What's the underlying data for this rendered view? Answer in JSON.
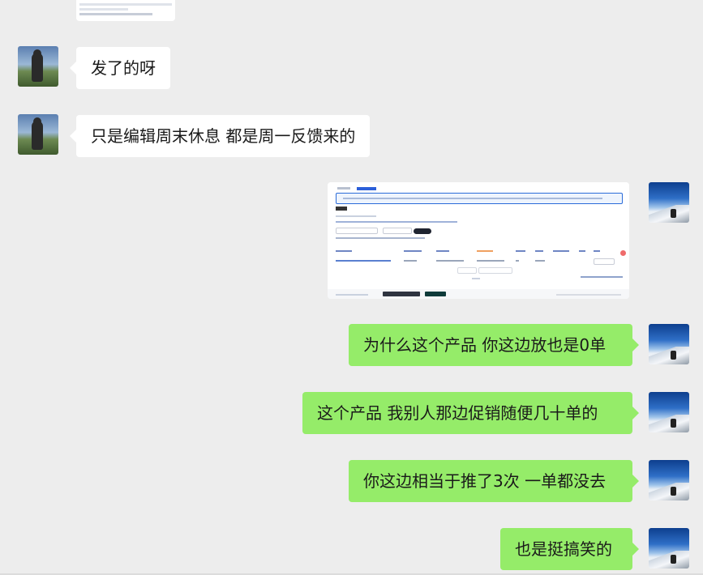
{
  "messages": [
    {
      "side": "left",
      "type": "text",
      "text": "发了的呀"
    },
    {
      "side": "left",
      "type": "text",
      "text": "只是编辑周末休息 都是周一反馈来的"
    },
    {
      "side": "right",
      "type": "image"
    },
    {
      "side": "right",
      "type": "text",
      "text": "为什么这个产品 你这边放也是0单"
    },
    {
      "side": "right",
      "type": "text",
      "text": "这个产品  我别人那边促销随便几十单的"
    },
    {
      "side": "right",
      "type": "text",
      "text": "你这边相当于推了3次 一单都没去"
    },
    {
      "side": "right",
      "type": "text",
      "text": "也是挺搞笑的"
    }
  ],
  "colors": {
    "background": "#ededed",
    "incoming_bubble": "#ffffff",
    "outgoing_bubble": "#95ec69",
    "text": "#1a1a1a"
  }
}
